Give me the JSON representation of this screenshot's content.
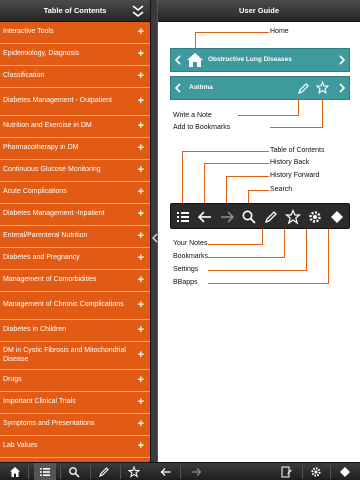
{
  "left_panel": {
    "title": "Table of Contents",
    "items": [
      {
        "label": "Interactive Tools"
      },
      {
        "label": "Epidemiology, Diagnosis"
      },
      {
        "label": "Classification"
      },
      {
        "label": "Diabetes Management - Outpatient"
      },
      {
        "label": "Nutrition and Exercise in DM"
      },
      {
        "label": "Pharmacotherapy in DM"
      },
      {
        "label": "Continuous Glucose Monitoring"
      },
      {
        "label": "Acute Complications"
      },
      {
        "label": "Diabetes Management -Inpatient"
      },
      {
        "label": "Enteral/Parenteral Nutrition"
      },
      {
        "label": "Diabetes and Pregnancy"
      },
      {
        "label": "Management of Comorbidities"
      },
      {
        "label": "Management of Chronic Complications"
      },
      {
        "label": "Diabetes in Children"
      },
      {
        "label": "DM in Cystic Fibrosis and Mitochondrial Disease"
      },
      {
        "label": "Drugs"
      },
      {
        "label": "Important Clinical Trials"
      },
      {
        "label": "Symptoms and Presentations"
      },
      {
        "label": "Lab Values"
      }
    ],
    "expand_glyph": "+"
  },
  "right_panel": {
    "title": "User Guide",
    "nav_bar": {
      "title": "Obstructive Lung Diseases"
    },
    "topic_bar": {
      "title": "Asthma"
    },
    "callouts": {
      "home": "Home",
      "write_note": "Write a Note",
      "add_bookmarks": "Add to Bookmarks",
      "table_of_contents": "Table of Contents",
      "history_back": "History Back",
      "history_forward": "History Forward",
      "search": "Search",
      "your_notes": "Your Notes",
      "bookmarks": "Bookmarks",
      "settings": "Settings",
      "bbapps": "BBapps"
    }
  },
  "bottom_bar": {
    "left_icons": [
      "home-icon",
      "list-icon",
      "search-icon",
      "pencil-icon",
      "star-icon"
    ],
    "right_icons": [
      "back-arrow-icon",
      "forward-arrow-icon",
      "notes-icon",
      "gear-icon",
      "diamond-icon"
    ]
  },
  "colors": {
    "orange": "#e05a14",
    "teal": "#3f9a9e",
    "dark": "#2b2b2b",
    "callout_line": "#e06010"
  }
}
